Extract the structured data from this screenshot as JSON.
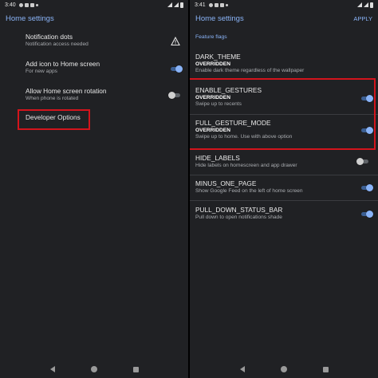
{
  "colors": {
    "accent": "#8ab4f8",
    "background": "#202124",
    "highlight": "#d3141c"
  },
  "left": {
    "status": {
      "time": "3:40"
    },
    "title": "Home settings",
    "items": [
      {
        "title": "Notification dots",
        "subtitle": "Notification access needed",
        "control": "warning-icon"
      },
      {
        "title": "Add icon to Home screen",
        "subtitle": "For new apps",
        "toggle": "on"
      },
      {
        "title": "Allow Home screen rotation",
        "subtitle": "When phone is rotated",
        "toggle": "off"
      },
      {
        "title": "Developer Options"
      }
    ]
  },
  "right": {
    "status": {
      "time": "3:41"
    },
    "title": "Home settings",
    "apply_label": "APPLY",
    "section": "Feature flags",
    "flags": [
      {
        "name": "DARK_THEME",
        "override": "OVERRIDDEN",
        "desc": "Enable dark theme regardless of the wallpaper",
        "toggle": "none"
      },
      {
        "name": "ENABLE_GESTURES",
        "override": "OVERRIDDEN",
        "desc": "Swipe up to recents",
        "toggle": "on"
      },
      {
        "name": "FULL_GESTURE_MODE",
        "override": "OVERRIDDEN",
        "desc": "Swipe up to home. Use with above option",
        "toggle": "on"
      },
      {
        "name": "HIDE_LABELS",
        "desc": "Hide labels on homescreen and app drawer",
        "toggle": "off"
      },
      {
        "name": "MINUS_ONE_PAGE",
        "desc": "Show Google Feed on the left of home screen",
        "toggle": "on"
      },
      {
        "name": "PULL_DOWN_STATUS_BAR",
        "desc": "Pull down to open notifications shade",
        "toggle": "on"
      }
    ]
  }
}
